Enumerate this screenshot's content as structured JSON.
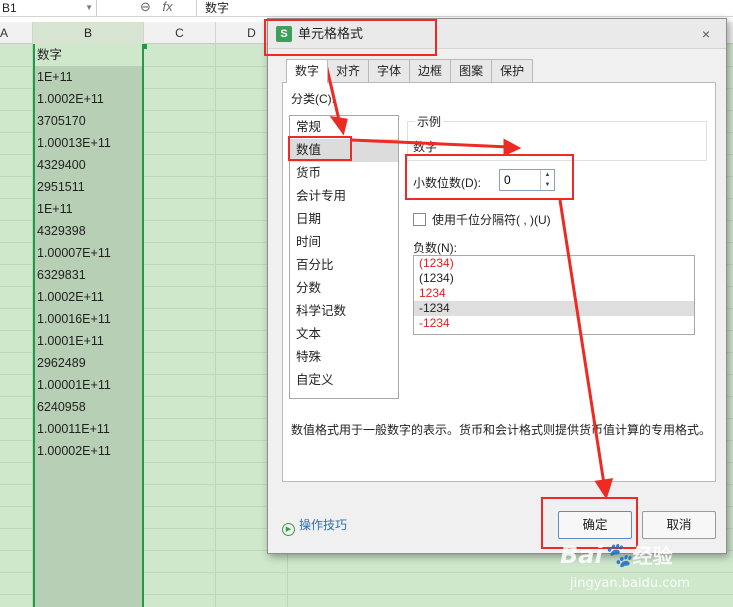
{
  "formula_bar": {
    "name_box": "B1",
    "fx_icons": [
      "zoom-icon",
      "fx-icon"
    ],
    "fx_text": "fx",
    "cell_value": "数字"
  },
  "columns": [
    "A",
    "B",
    "C",
    "D"
  ],
  "column_b": [
    "数字",
    "1E+11",
    "1.0002E+11",
    "3705170",
    "1.00013E+11",
    "4329400",
    "2951511",
    "1E+11",
    "4329398",
    "1.00007E+11",
    "6329831",
    "1.0002E+11",
    "1.00016E+11",
    "1.0001E+11",
    "2962489",
    "1.00001E+11",
    "6240958",
    "1.00011E+11",
    "1.00002E+11"
  ],
  "dialog": {
    "title": "单元格格式",
    "app_icon_letter": "S",
    "tabs": [
      "数字",
      "对齐",
      "字体",
      "边框",
      "图案",
      "保护"
    ],
    "active_tab": "数字",
    "category_label": "分类(C):",
    "categories": [
      "常规",
      "数值",
      "货币",
      "会计专用",
      "日期",
      "时间",
      "百分比",
      "分数",
      "科学记数",
      "文本",
      "特殊",
      "自定义"
    ],
    "selected_category": "数值",
    "sample_label": "示例",
    "sample_value": "数字",
    "decimals_label": "小数位数(D):",
    "decimals_value": "0",
    "thousand_separator_label": "使用千位分隔符( , )(U)",
    "negative_label": "负数(N):",
    "negative_options": [
      {
        "text": "(1234)",
        "color": "#e02020"
      },
      {
        "text": "(1234)",
        "color": "#222222"
      },
      {
        "text": "1234",
        "color": "#e02020"
      },
      {
        "text": "-1234",
        "color": "#222222"
      },
      {
        "text": "-1234",
        "color": "#e02020"
      }
    ],
    "selected_negative": "-1234",
    "description": "数值格式用于一般数字的表示。货币和会计格式则提供货币值计算的专用格式。",
    "tips_label": "操作技巧",
    "ok_label": "确定",
    "cancel_label": "取消",
    "close_label": "×"
  },
  "annotation_color": "#ee2a24",
  "watermark": {
    "brand": "Bai",
    "brand2": "经验",
    "url": "jingyan.baidu.com"
  }
}
